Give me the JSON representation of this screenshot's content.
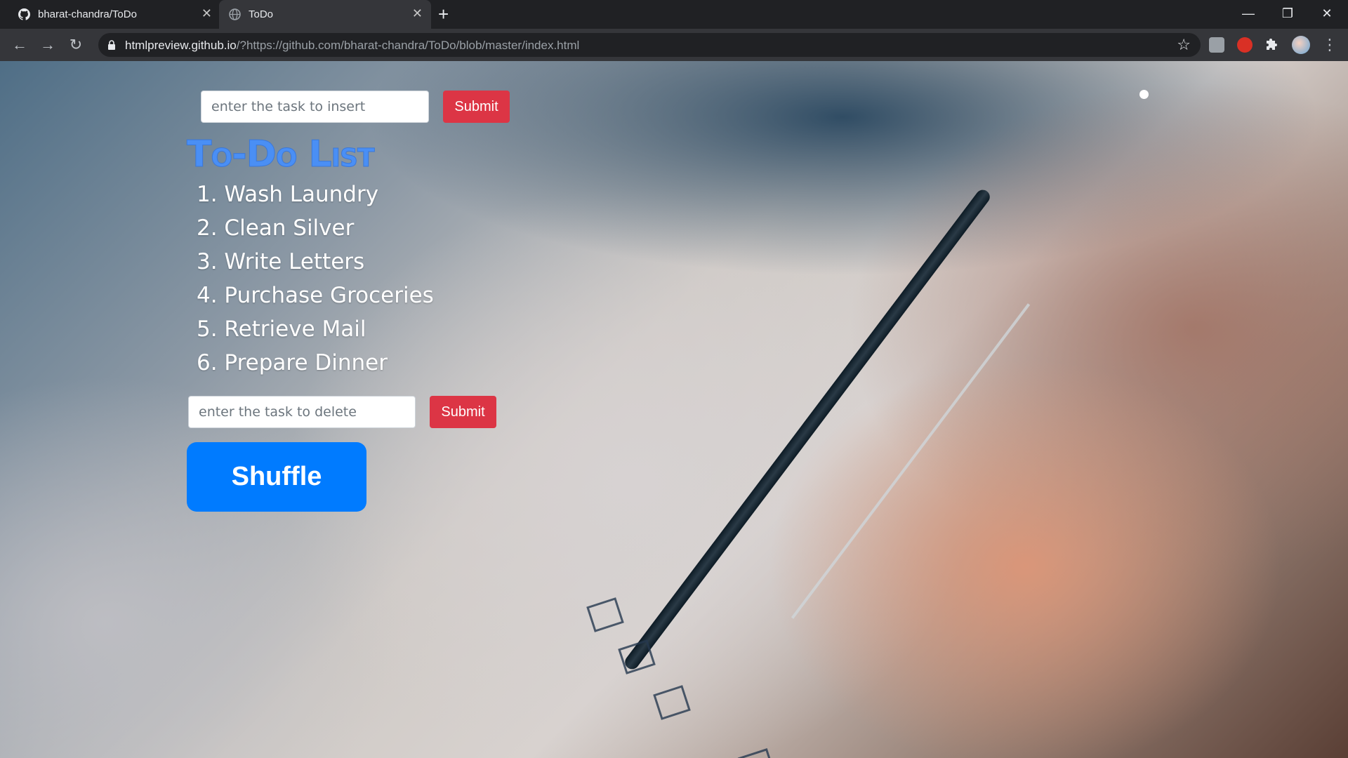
{
  "browser": {
    "tabs": [
      {
        "title": "bharat-chandra/ToDo",
        "icon": "github-icon",
        "active": false
      },
      {
        "title": "ToDo",
        "icon": "globe-icon",
        "active": true
      }
    ],
    "new_tab": "+",
    "window_controls": {
      "minimize": "—",
      "restore": "❐",
      "close": "✕"
    },
    "url_host": "htmlpreview.github.io",
    "url_rest": "/?https://github.com/bharat-chandra/ToDo/blob/master/index.html",
    "nav": {
      "back": "←",
      "forward": "→",
      "reload": "↻"
    },
    "bookmark_icon": "☆",
    "menu_icon": "⋮"
  },
  "page": {
    "insert": {
      "placeholder": "enter the task to insert",
      "submit_label": "Submit"
    },
    "title": "To-Do List",
    "tasks": [
      "1. Wash Laundry",
      "2. Clean Silver",
      "3. Write Letters",
      "4. Purchase Groceries",
      "5. Retrieve Mail",
      "6. Prepare Dinner"
    ],
    "delete": {
      "placeholder": "enter the task to delete",
      "submit_label": "Submit"
    },
    "shuffle_label": "Shuffle"
  },
  "colors": {
    "submit": "#dc3545",
    "shuffle": "#007bff",
    "title": "#4a8ff5"
  }
}
